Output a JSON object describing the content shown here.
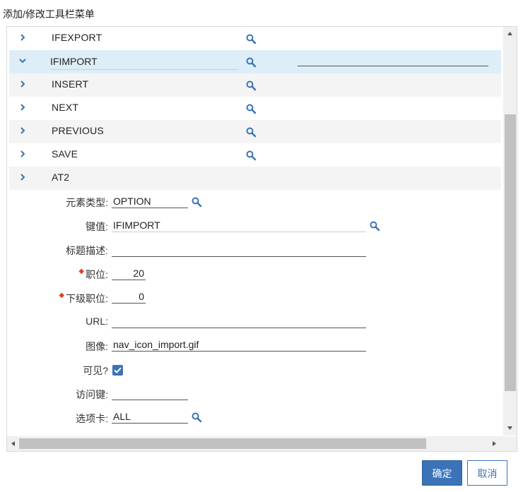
{
  "dialog": {
    "title": "添加/修改工具栏菜单"
  },
  "rows": [
    {
      "name": "IFEXPORT",
      "has_search": true
    },
    {
      "name": "IFIMPORT",
      "has_search": true,
      "expanded": true,
      "selected": true
    },
    {
      "name": "INSERT",
      "has_search": true
    },
    {
      "name": "NEXT",
      "has_search": true
    },
    {
      "name": "PREVIOUS",
      "has_search": true
    },
    {
      "name": "SAVE",
      "has_search": true
    },
    {
      "name": "AT2",
      "has_search": false
    }
  ],
  "form": {
    "element_type": {
      "label": "元素类型:",
      "value": "OPTION"
    },
    "key_value": {
      "label": "键值:",
      "value": "IFIMPORT"
    },
    "title_desc": {
      "label": "标题描述:",
      "value": ""
    },
    "position": {
      "label": "职位:",
      "value": "20",
      "required": true
    },
    "sub_position": {
      "label": "下级职位:",
      "value": "0",
      "required": true
    },
    "url": {
      "label": "URL:",
      "value": ""
    },
    "image": {
      "label": "图像:",
      "value": "nav_icon_import.gif"
    },
    "visible": {
      "label": "可见?",
      "checked": true
    },
    "access_key": {
      "label": "访问键:",
      "value": ""
    },
    "tab": {
      "label": "选项卡:",
      "value": "ALL"
    }
  },
  "buttons": {
    "ok": "确定",
    "cancel": "取消"
  },
  "colors": {
    "accent": "#3a73b8",
    "selected_row": "#deeef8",
    "alt_row": "#f4f4f4",
    "required": "#e0421e"
  },
  "icons": {
    "row_expand": "chevron-right-icon",
    "row_collapse": "chevron-down-icon",
    "lookup": "search-icon"
  }
}
